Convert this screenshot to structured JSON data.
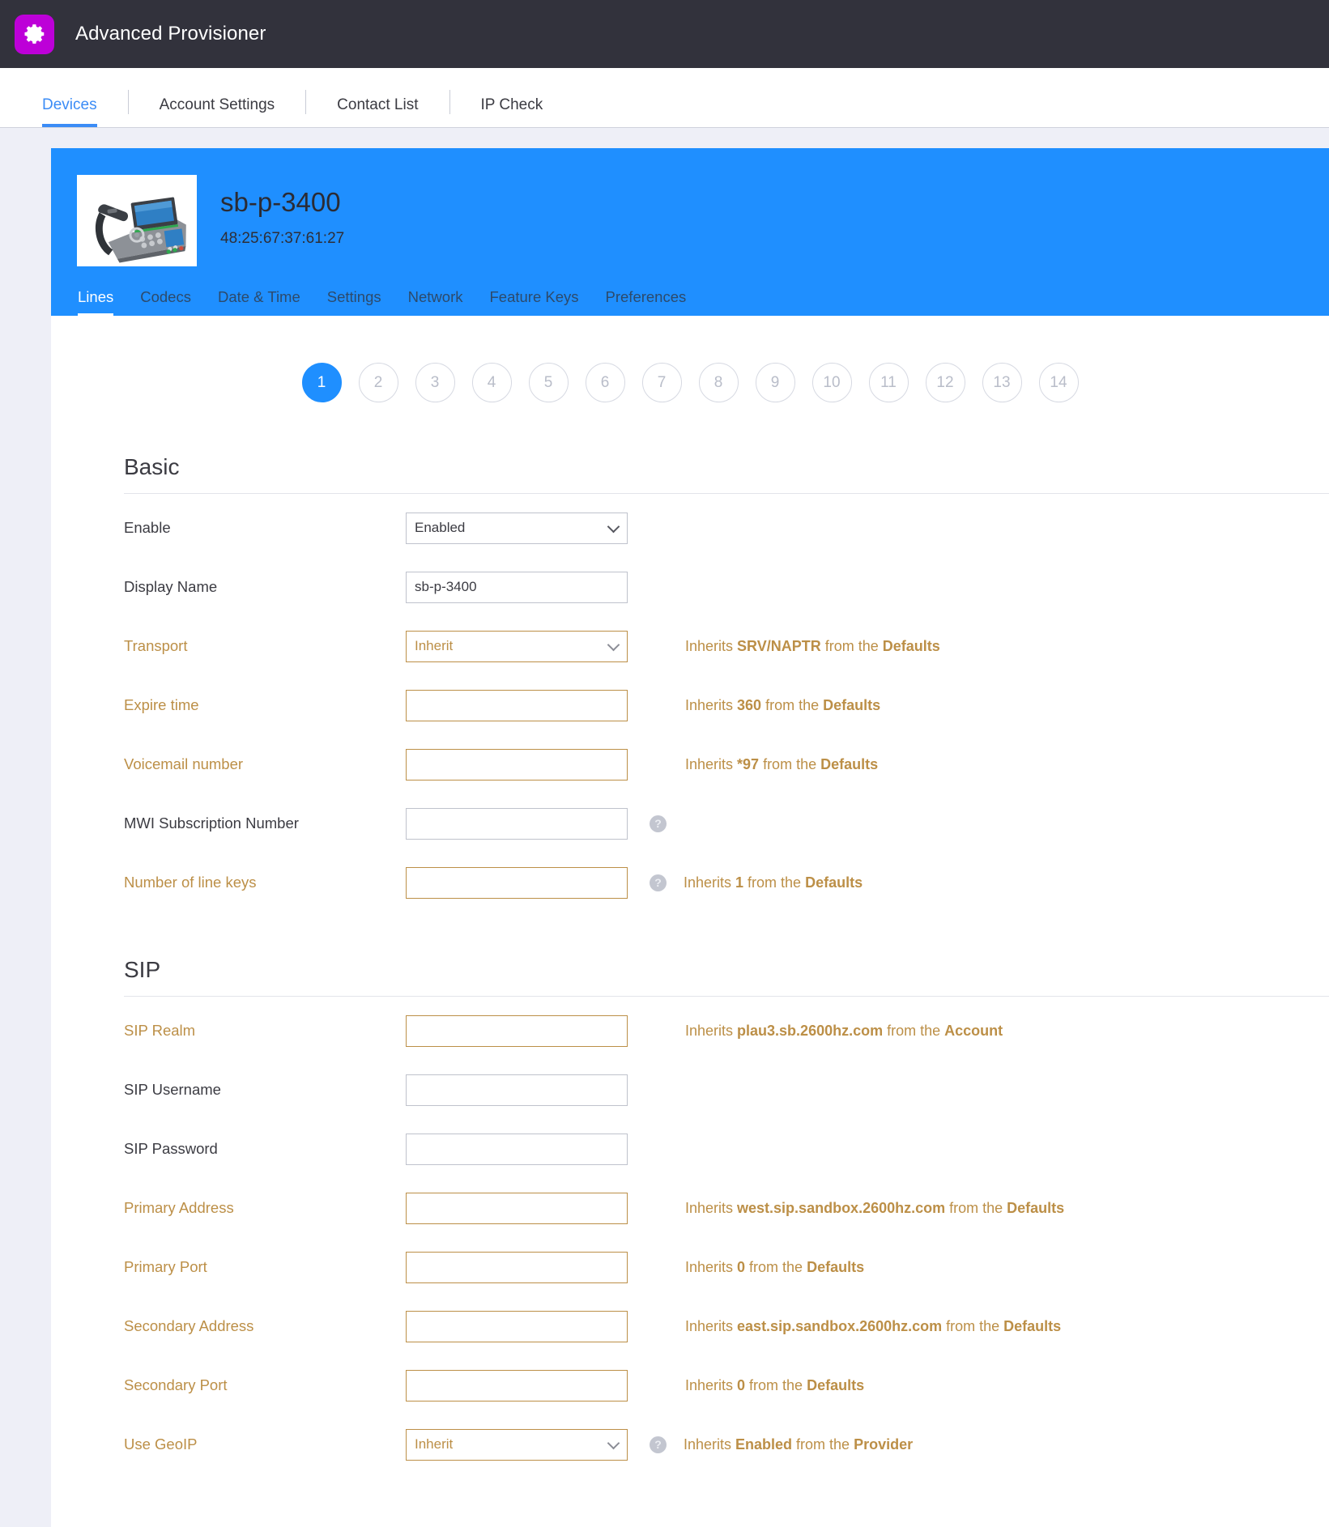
{
  "app": {
    "title": "Advanced Provisioner",
    "logo_icon": "gear-icon",
    "logo_color": "#bd00d8",
    "bar_color": "#32323c"
  },
  "main_nav": {
    "items": [
      {
        "label": "Devices",
        "active": true
      },
      {
        "label": "Account Settings",
        "active": false
      },
      {
        "label": "Contact List",
        "active": false
      },
      {
        "label": "IP Check",
        "active": false
      }
    ],
    "accent_color": "#3b8cf6"
  },
  "device": {
    "name": "sb-p-3400",
    "mac_address": "48:25:67:37:61:27",
    "thumbnail_alt": "desk-phone-photo",
    "hero_color": "#1f8fff",
    "subtabs": [
      {
        "label": "Lines",
        "active": true
      },
      {
        "label": "Codecs",
        "active": false
      },
      {
        "label": "Date & Time",
        "active": false
      },
      {
        "label": "Settings",
        "active": false
      },
      {
        "label": "Network",
        "active": false
      },
      {
        "label": "Feature Keys",
        "active": false
      },
      {
        "label": "Preferences",
        "active": false
      }
    ]
  },
  "line_pager": {
    "selected": "1",
    "pills": [
      "1",
      "2",
      "3",
      "4",
      "5",
      "6",
      "7",
      "8",
      "9",
      "10",
      "11",
      "12",
      "13",
      "14"
    ]
  },
  "sections": [
    {
      "title": "Basic",
      "rows": [
        {
          "label": "Enable",
          "control": "select",
          "value": "Enabled",
          "inherited": false,
          "help": false,
          "hint": null
        },
        {
          "label": "Display Name",
          "control": "text",
          "value": "sb-p-3400",
          "inherited": false,
          "help": false,
          "hint": null
        },
        {
          "label": "Transport",
          "control": "select",
          "value": "Inherit",
          "inherited": true,
          "help": false,
          "hint": {
            "prefix": "Inherits ",
            "value": "SRV/NAPTR",
            "middle": " from the ",
            "source": "Defaults"
          }
        },
        {
          "label": "Expire time",
          "control": "text",
          "value": "",
          "inherited": true,
          "help": false,
          "hint": {
            "prefix": "Inherits ",
            "value": "360",
            "middle": " from the ",
            "source": "Defaults"
          }
        },
        {
          "label": "Voicemail number",
          "control": "text",
          "value": "",
          "inherited": true,
          "help": false,
          "hint": {
            "prefix": "Inherits ",
            "value": "*97",
            "middle": " from the ",
            "source": "Defaults"
          }
        },
        {
          "label": "MWI Subscription Number",
          "control": "text",
          "value": "",
          "inherited": false,
          "help": true,
          "hint": null
        },
        {
          "label": "Number of line keys",
          "control": "text",
          "value": "",
          "inherited": true,
          "help": true,
          "hint": {
            "prefix": "Inherits ",
            "value": "1",
            "middle": " from the ",
            "source": "Defaults"
          }
        }
      ]
    },
    {
      "title": "SIP",
      "rows": [
        {
          "label": "SIP Realm",
          "control": "text",
          "value": "",
          "inherited": true,
          "help": false,
          "hint": {
            "prefix": "Inherits ",
            "value": "plau3.sb.2600hz.com",
            "middle": " from the ",
            "source": "Account"
          }
        },
        {
          "label": "SIP Username",
          "control": "text",
          "value": "",
          "inherited": false,
          "help": false,
          "hint": null
        },
        {
          "label": "SIP Password",
          "control": "text",
          "value": "",
          "inherited": false,
          "help": false,
          "hint": null
        },
        {
          "label": "Primary Address",
          "control": "text",
          "value": "",
          "inherited": true,
          "help": false,
          "hint": {
            "prefix": "Inherits ",
            "value": "west.sip.sandbox.2600hz.com",
            "middle": " from the ",
            "source": "Defaults"
          }
        },
        {
          "label": "Primary Port",
          "control": "text",
          "value": "",
          "inherited": true,
          "help": false,
          "hint": {
            "prefix": "Inherits ",
            "value": "0",
            "middle": " from the ",
            "source": "Defaults"
          }
        },
        {
          "label": "Secondary Address",
          "control": "text",
          "value": "",
          "inherited": true,
          "help": false,
          "hint": {
            "prefix": "Inherits ",
            "value": "east.sip.sandbox.2600hz.com",
            "middle": " from the ",
            "source": "Defaults"
          }
        },
        {
          "label": "Secondary Port",
          "control": "text",
          "value": "",
          "inherited": true,
          "help": false,
          "hint": {
            "prefix": "Inherits ",
            "value": "0",
            "middle": " from the ",
            "source": "Defaults"
          }
        },
        {
          "label": "Use GeoIP",
          "control": "select",
          "value": "Inherit",
          "inherited": true,
          "help": true,
          "hint": {
            "prefix": "Inherits ",
            "value": "Enabled",
            "middle": " from the ",
            "source": "Provider"
          }
        }
      ]
    }
  ],
  "icons": {
    "help": "?",
    "chevron_down": "chevron-down-icon"
  }
}
